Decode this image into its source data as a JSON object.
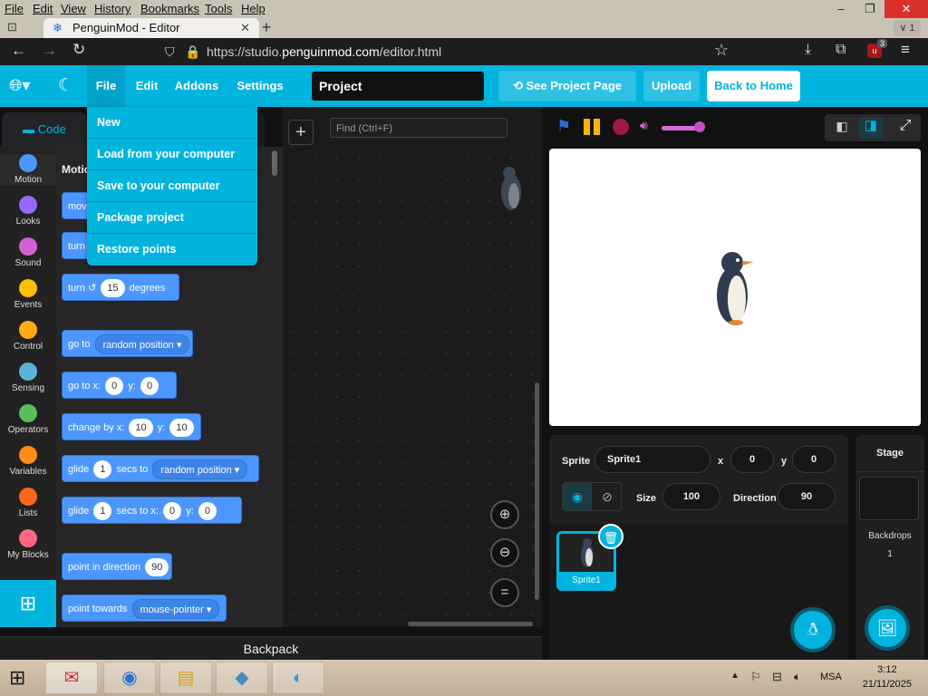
{
  "browser": {
    "menu": [
      "File",
      "Edit",
      "View",
      "History",
      "Bookmarks",
      "Tools",
      "Help"
    ],
    "tab_title": "PenguinMod - Editor",
    "url_prefix": "https://studio.",
    "url_domain": "penguinmod.com",
    "url_path": "/editor.html",
    "tab_count": "1",
    "ext_badge": "3"
  },
  "header": {
    "menus": [
      "File",
      "Edit",
      "Addons",
      "Settings"
    ],
    "project_title": "Project",
    "see_project_page": "See Project Page",
    "upload": "Upload",
    "back_home": "Back to Home"
  },
  "file_menu": [
    "New",
    "Load from your computer",
    "Save to your computer",
    "Package project",
    "Restore points"
  ],
  "tabs": {
    "code": "Code",
    "partial": "s"
  },
  "find_placeholder": "Find (Ctrl+F)",
  "categories": [
    {
      "name": "Motion",
      "color": "#4c97ff"
    },
    {
      "name": "Looks",
      "color": "#9966ff"
    },
    {
      "name": "Sound",
      "color": "#cf63cf"
    },
    {
      "name": "Events",
      "color": "#ffbf00"
    },
    {
      "name": "Control",
      "color": "#ffab19"
    },
    {
      "name": "Sensing",
      "color": "#5cb1d6"
    },
    {
      "name": "Operators",
      "color": "#59c059"
    },
    {
      "name": "Variables",
      "color": "#ff8c1a"
    },
    {
      "name": "Lists",
      "color": "#ff661a"
    },
    {
      "name": "My Blocks",
      "color": "#ff6680"
    }
  ],
  "palette": {
    "heading": "Motio",
    "move_partial": "move",
    "turn_partial": "turn",
    "turn_label": "turn",
    "turn_value": "15",
    "degrees": "degrees",
    "goto_label": "go to",
    "goto_option": "random position",
    "gotoxy_label": "go to x:",
    "x0": "0",
    "y_label": "y:",
    "y0": "0",
    "changeby_label": "change by x:",
    "cx": "10",
    "cy": "10",
    "glide_label": "glide",
    "glide_secs": "1",
    "secs_to": "secs to",
    "glide_option": "random position",
    "secs_to_x": "secs to x:",
    "gx": "0",
    "gy": "0",
    "point_dir_label": "point in direction",
    "dir_val": "90",
    "point_towards_label": "point towards",
    "towards_option": "mouse-pointer"
  },
  "backpack": "Backpack",
  "sprite_info": {
    "sprite_label": "Sprite",
    "sprite_name": "Sprite1",
    "x_label": "x",
    "x": "0",
    "y_label": "y",
    "y": "0",
    "size_label": "Size",
    "size": "100",
    "direction_label": "Direction",
    "direction": "90",
    "thumb_label": "Sprite1"
  },
  "stage_panel": {
    "title": "Stage",
    "backdrops_label": "Backdrops",
    "backdrops_count": "1"
  },
  "taskbar": {
    "lang": "MSA",
    "time": "3:12",
    "date": "21/11/2025"
  },
  "colors": {
    "accent": "#00b4de",
    "motion": "#4c97ff"
  }
}
